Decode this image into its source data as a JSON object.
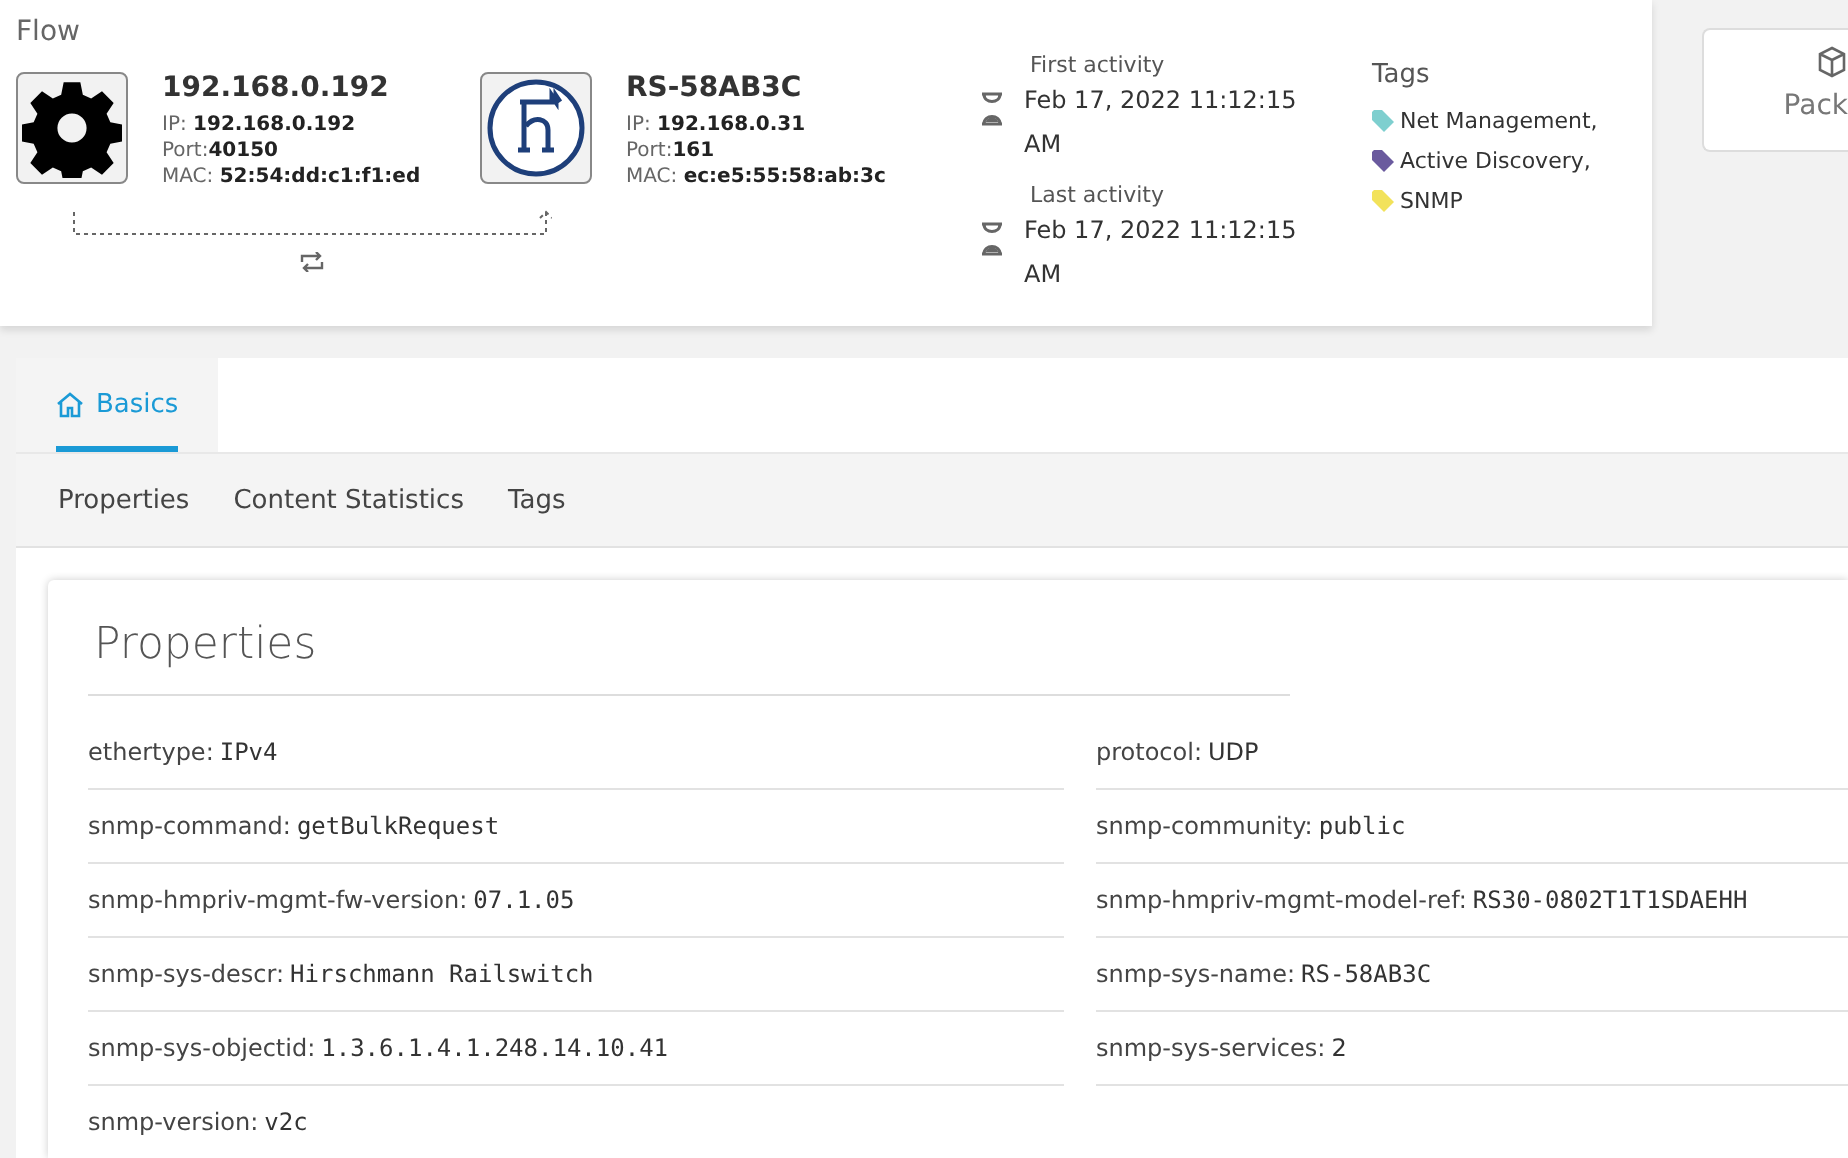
{
  "flow": {
    "title": "Flow",
    "source": {
      "kind": "gear",
      "name": "192.168.0.192",
      "ip_label": "IP:",
      "ip": "192.168.0.192",
      "port_label": "Port:",
      "port": "40150",
      "mac_label": "MAC:",
      "mac": "52:54:dd:c1:f1:ed"
    },
    "destination": {
      "kind": "logo",
      "name": "RS-58AB3C",
      "ip_label": "IP:",
      "ip": "192.168.0.31",
      "port_label": "Port:",
      "port": "161",
      "mac_label": "MAC:",
      "mac": "ec:e5:55:58:ab:3c"
    },
    "activity": [
      {
        "label": "First activity",
        "value": "Feb 17, 2022 11:12:15 AM"
      },
      {
        "label": "Last activity",
        "value": "Feb 17, 2022 11:12:15 AM"
      }
    ],
    "tags": {
      "title": "Tags",
      "items": [
        {
          "label": "Net Management,",
          "color": "#7ecfcf"
        },
        {
          "label": "Active Discovery,",
          "color": "#6a5a9e"
        },
        {
          "label": "SNMP",
          "color": "#f2e25a"
        }
      ]
    },
    "side_card": {
      "label": "Pack"
    }
  },
  "tabs": [
    {
      "label": "Basics",
      "selected": true
    }
  ],
  "subtabs": [
    {
      "label": "Properties"
    },
    {
      "label": "Content Statistics"
    },
    {
      "label": "Tags"
    }
  ],
  "properties": {
    "title": "Properties",
    "rows": [
      {
        "key": "ethertype:",
        "value": "IPv4",
        "mono": true
      },
      {
        "key": "protocol:",
        "value": "UDP",
        "mono": false
      },
      {
        "key": "snmp-command:",
        "value": "getBulkRequest",
        "mono": true
      },
      {
        "key": "snmp-community:",
        "value": "public",
        "mono": true
      },
      {
        "key": "snmp-hmpriv-mgmt-fw-version:",
        "value": "07.1.05",
        "mono": true
      },
      {
        "key": "snmp-hmpriv-mgmt-model-ref:",
        "value": "RS30-0802T1T1SDAEHH",
        "mono": true
      },
      {
        "key": "snmp-sys-descr:",
        "value": "Hirschmann Railswitch",
        "mono": true
      },
      {
        "key": "snmp-sys-name:",
        "value": "RS-58AB3C",
        "mono": true
      },
      {
        "key": "snmp-sys-objectid:",
        "value": "1.3.6.1.4.1.248.14.10.41",
        "mono": true
      },
      {
        "key": "snmp-sys-services:",
        "value": "2",
        "mono": false
      },
      {
        "key": "snmp-version:",
        "value": "v2c",
        "mono": true
      }
    ]
  }
}
